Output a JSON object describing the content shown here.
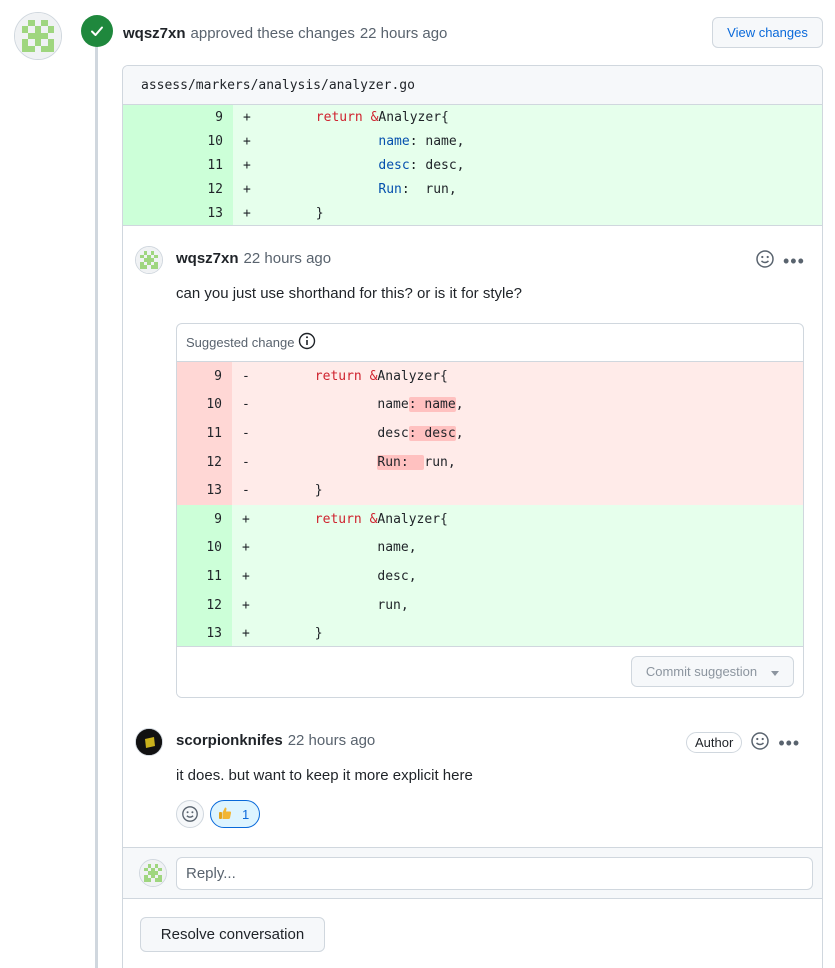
{
  "review": {
    "user": "wqsz7xn",
    "action": "approved these changes",
    "time": "22 hours ago",
    "view_changes": "View changes"
  },
  "file": {
    "path": "assess/markers/analysis/analyzer.go"
  },
  "diff_top": [
    {
      "ln": "9",
      "sign": "+"
    },
    {
      "ln": "10",
      "sign": "+"
    },
    {
      "ln": "11",
      "sign": "+"
    },
    {
      "ln": "12",
      "sign": "+"
    },
    {
      "ln": "13",
      "sign": "+"
    }
  ],
  "code": {
    "return_kw": "return",
    "amp": "&",
    "analyzer_open": "Analyzer{",
    "name_field": "name",
    "desc_field": "desc",
    "run_field": "Run",
    "name_val": ": name,",
    "desc_val": ": desc,",
    "run_val": ":  run,",
    "close": "}",
    "name_short": "name,",
    "desc_short": "desc,",
    "run_short": "run,",
    "name_hl": ": name",
    "desc_hl": ": desc",
    "run_hl_field": "Run:  ",
    "comma": ",",
    "run_rest": "run,"
  },
  "comment1": {
    "user": "wqsz7xn",
    "time": "22 hours ago",
    "body": "can you just use shorthand for this? or is it for style?",
    "suggested_change_label": "Suggested change",
    "commit_label": "Commit suggestion",
    "deleted_lines": [
      "9",
      "10",
      "11",
      "12",
      "13"
    ],
    "added_lines": [
      "9",
      "10",
      "11",
      "12",
      "13"
    ],
    "del_sign": "-",
    "add_sign": "+"
  },
  "comment2": {
    "user": "scorpionknifes",
    "time": "22 hours ago",
    "badge": "Author",
    "body": "it does. but want to keep it more explicit here",
    "reaction_count": "1"
  },
  "reply": {
    "placeholder": "Reply...",
    "resolve_label": "Resolve conversation"
  },
  "colors": {
    "approved_green": "#1f883d",
    "add_bg": "#e6ffec",
    "del_bg": "#ffebe9",
    "link_blue": "#0969da"
  }
}
